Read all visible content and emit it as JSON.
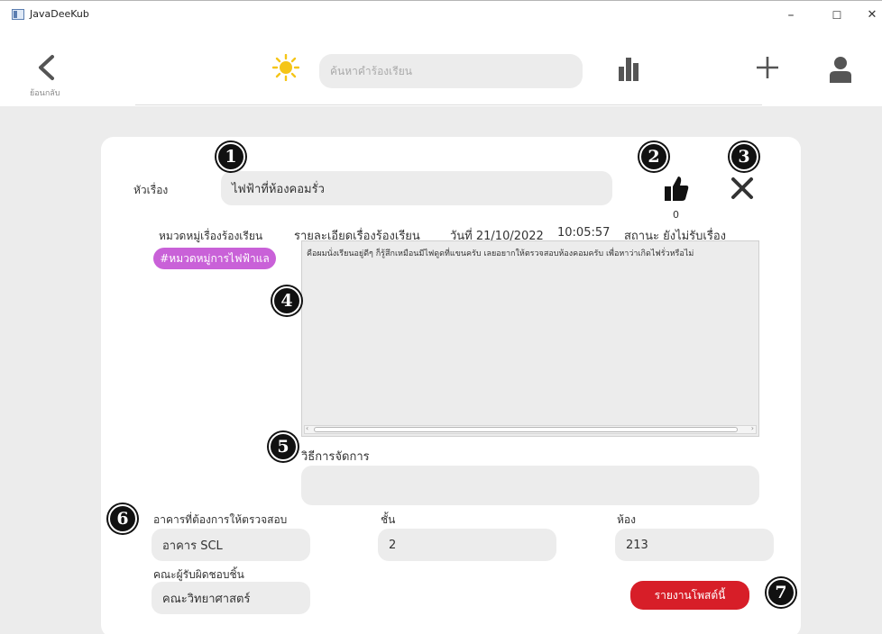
{
  "window": {
    "title": "JavaDeeKub",
    "minimize": "–",
    "maximize": "☐",
    "close": "✕"
  },
  "header": {
    "back_label": "ย้อนกลับ",
    "search_placeholder": "ค้นหาคำร้องเรียน"
  },
  "markers": [
    "1",
    "2",
    "3",
    "4",
    "5",
    "6",
    "7"
  ],
  "complaint": {
    "topic_label": "หัวเรื่อง",
    "topic_value": "ไฟฟ้าที่ห้องคอมรั่ว",
    "like_count": "0",
    "category_label": "หมวดหมู่เรื่องร้องเรียน",
    "category_value": "#หมวดหมู่การไฟฟ้าแล",
    "detail_label": "รายละเอียดเรื่องร้องเรียน",
    "date_label": "วันที่ 21/10/2022",
    "time_label": "10:05:57",
    "status_label": "สถานะ ยังไม่รับเรื่อง",
    "detail_text": "คือผมนั่งเรียนอยู่ดีๆ ก็รู้สึกเหมือนมีไฟดูดที่แขนครับ เลยอยากให้ตรวจสอบห้องคอมครับ เพื่อหาว่าเกิดไฟรั่วหรือไม่",
    "method_label": "วิธีการจัดการ",
    "method_value": ""
  },
  "location": {
    "building_label": "อาคารที่ต้องการให้ตรวจสอบ",
    "building_value": "อาคาร SCL",
    "floor_label": "ชั้น",
    "floor_value": "2",
    "room_label": "ห้อง",
    "room_value": "213",
    "faculty_label": "คณะผู้รับผิดชอบชิ้น",
    "faculty_value": "คณะวิทยาศาสตร์"
  },
  "actions": {
    "report_label": "รายงานโพสต์นี้"
  },
  "colors": {
    "category_chip": "#c961d8",
    "report_button": "#d71e28",
    "sun": "#f5c518",
    "background": "#ececec"
  }
}
